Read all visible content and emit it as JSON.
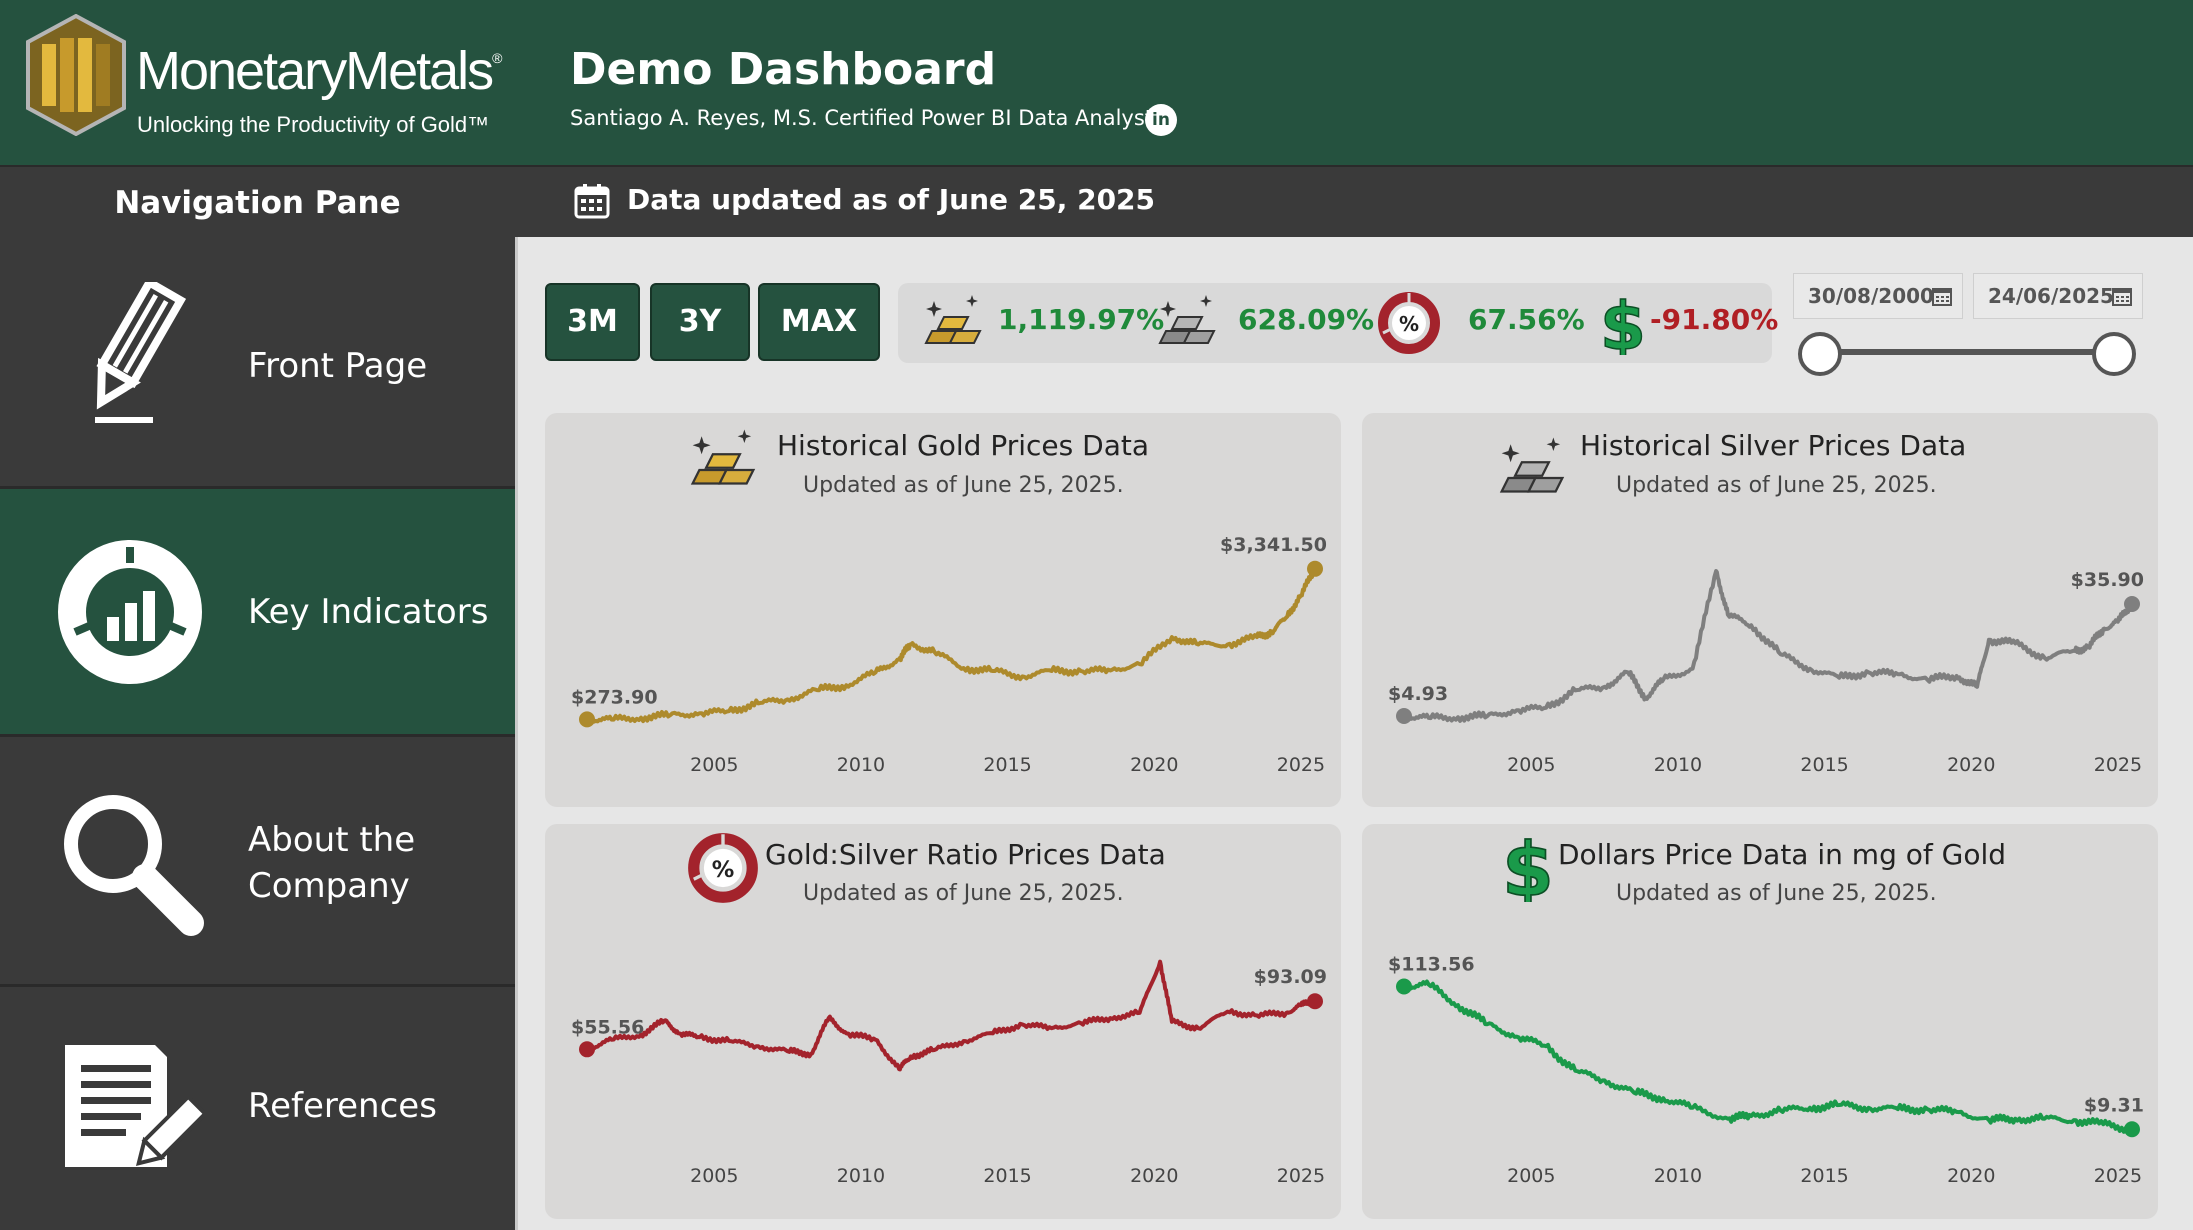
{
  "header": {
    "logo_name": "MonetaryMetals",
    "logo_reg": "®",
    "logo_tagline": "Unlocking the Productivity of Gold™",
    "title": "Demo Dashboard",
    "subtitle": "Santiago A. Reyes, M.S. Certified Power BI Data Analyst.",
    "linkedin_label": "in"
  },
  "bar": {
    "nav_title": "Navigation Pane",
    "updated": "Data updated as of June 25, 2025"
  },
  "sidebar": {
    "items": [
      {
        "label": "Front Page",
        "icon": "pencil-icon",
        "active": false
      },
      {
        "label": "Key Indicators",
        "icon": "donut-chart-icon",
        "active": true
      },
      {
        "label": "About the Company",
        "icon": "magnifier-icon",
        "active": false
      },
      {
        "label": "References",
        "icon": "document-edit-icon",
        "active": false
      }
    ]
  },
  "controls": {
    "ranges": [
      "3M",
      "3Y",
      "MAX"
    ],
    "kpis": [
      {
        "icon": "gold-bars-icon",
        "value": "1,119.97%",
        "color": "#1f8a3a"
      },
      {
        "icon": "silver-bars-icon",
        "value": "628.09%",
        "color": "#1f8a3a"
      },
      {
        "icon": "percent-ratio-icon",
        "value": "67.56%",
        "color": "#1f8a3a"
      },
      {
        "icon": "dollar-icon",
        "value": "-91.80%",
        "color": "#b01f24"
      }
    ],
    "date_start": "30/08/2000",
    "date_end": "24/06/2025"
  },
  "colors": {
    "brand_green": "#25523f",
    "gold": "#ad8a2c",
    "silver": "#7f7f7f",
    "ratio": "#a3232c",
    "dollar": "#1a9a4a",
    "positive": "#1f8a3a",
    "negative": "#b01f24"
  },
  "cards": [
    {
      "title": "Historical Gold Prices Data",
      "subtitle": "Updated as of June 25, 2025.",
      "icon": "gold-bars-icon",
      "start_label": "$273.90",
      "end_label": "$3,341.50"
    },
    {
      "title": "Historical Silver Prices Data",
      "subtitle": "Updated as of June 25, 2025.",
      "icon": "silver-bars-icon",
      "start_label": "$4.93",
      "end_label": "$35.90"
    },
    {
      "title": "Gold:Silver Ratio Prices Data",
      "subtitle": "Updated as of June 25, 2025.",
      "icon": "percent-ratio-icon",
      "start_label": "$55.56",
      "end_label": "$93.09"
    },
    {
      "title": "Dollars Price Data in mg of Gold",
      "subtitle": "Updated as of June 25, 2025.",
      "icon": "dollar-icon",
      "start_label": "$113.56",
      "end_label": "$9.31"
    }
  ],
  "chart_data": [
    {
      "type": "line",
      "title": "Historical Gold Prices Data",
      "xlim": [
        2000.66,
        2025.48
      ],
      "ylim": [
        200,
        3500
      ],
      "x_ticks": [
        "2005",
        "2010",
        "2015",
        "2020",
        "2025"
      ],
      "grid": false,
      "series": [
        {
          "color": "#ad8a2c",
          "x": [
            2000.66,
            2001.5,
            2002.5,
            2003.5,
            2004.5,
            2005.5,
            2006.5,
            2007.5,
            2008.5,
            2009.5,
            2010.5,
            2011.3,
            2011.7,
            2012.5,
            2013.5,
            2014.5,
            2015.5,
            2016.5,
            2017.5,
            2018.5,
            2019.5,
            2020.6,
            2021.5,
            2022.5,
            2023.5,
            2024.0,
            2024.5,
            2025.0,
            2025.48
          ],
          "y": [
            273.9,
            270,
            310,
            360,
            400,
            440,
            600,
            680,
            870,
            970,
            1230,
            1500,
            1800,
            1650,
            1320,
            1260,
            1150,
            1260,
            1260,
            1270,
            1400,
            1950,
            1800,
            1800,
            1950,
            2050,
            2350,
            2800,
            3341.5
          ]
        }
      ]
    },
    {
      "type": "line",
      "title": "Historical Silver Prices Data",
      "xlim": [
        2000.66,
        2025.48
      ],
      "ylim": [
        3,
        50
      ],
      "x_ticks": [
        "2005",
        "2010",
        "2015",
        "2020",
        "2025"
      ],
      "grid": false,
      "series": [
        {
          "color": "#7f7f7f",
          "x": [
            2000.66,
            2001.5,
            2002.5,
            2003.5,
            2004.5,
            2005.5,
            2006.5,
            2007.5,
            2008.3,
            2008.9,
            2009.5,
            2010.5,
            2011.3,
            2011.7,
            2012.5,
            2013.5,
            2014.5,
            2015.5,
            2016.5,
            2017.5,
            2018.5,
            2019.5,
            2020.2,
            2020.6,
            2021.5,
            2022.5,
            2023.5,
            2024.0,
            2024.5,
            2025.0,
            2025.48
          ],
          "y": [
            4.93,
            4.4,
            4.6,
            4.9,
            6.5,
            7.2,
            12,
            13,
            17,
            10,
            15,
            18,
            45,
            33,
            30,
            22,
            18,
            15.5,
            17,
            16.5,
            15,
            16,
            13,
            26,
            25,
            21,
            23,
            24,
            29,
            31,
            35.9
          ]
        }
      ]
    },
    {
      "type": "line",
      "title": "Gold:Silver Ratio Prices Data",
      "xlim": [
        2000.66,
        2025.48
      ],
      "ylim": [
        30,
        130
      ],
      "x_ticks": [
        "2005",
        "2010",
        "2015",
        "2020",
        "2025"
      ],
      "grid": false,
      "series": [
        {
          "color": "#a3232c",
          "x": [
            2000.66,
            2001.5,
            2002.5,
            2003.3,
            2003.8,
            2004.5,
            2005.5,
            2006.5,
            2007.5,
            2008.3,
            2008.9,
            2009.5,
            2010.5,
            2011.3,
            2011.7,
            2012.5,
            2013.5,
            2014.5,
            2015.5,
            2016.5,
            2017.5,
            2018.5,
            2019.5,
            2020.2,
            2020.6,
            2021.5,
            2022.5,
            2023.5,
            2024.5,
            2025.0,
            2025.48
          ],
          "y": [
            55.56,
            63,
            67,
            78,
            68,
            65,
            62,
            58,
            54,
            52,
            80,
            68,
            63,
            40,
            50,
            55,
            62,
            68,
            75,
            72,
            76,
            80,
            84,
            124,
            77,
            72,
            85,
            82,
            84,
            90,
            93.09
          ]
        }
      ]
    },
    {
      "type": "line",
      "title": "Dollars Price Data in mg of Gold",
      "xlim": [
        2000.66,
        2025.48
      ],
      "ylim": [
        0,
        130
      ],
      "x_ticks": [
        "2005",
        "2010",
        "2015",
        "2020",
        "2025"
      ],
      "grid": false,
      "series": [
        {
          "color": "#1a9a4a",
          "x": [
            2000.66,
            2001.5,
            2002.5,
            2003.5,
            2004.5,
            2005.5,
            2006.5,
            2007.5,
            2008.5,
            2009.5,
            2010.5,
            2011.7,
            2012.5,
            2013.5,
            2014.5,
            2015.5,
            2016.5,
            2017.5,
            2018.5,
            2019.5,
            2020.6,
            2021.5,
            2022.5,
            2023.5,
            2024.5,
            2025.48
          ],
          "y": [
            113.56,
            115,
            100,
            86,
            77,
            70,
            52,
            45,
            36,
            32,
            25,
            17,
            19,
            23,
            25,
            27,
            25,
            24,
            24,
            22,
            16,
            17,
            17,
            16,
            13,
            9.31
          ]
        }
      ]
    }
  ]
}
